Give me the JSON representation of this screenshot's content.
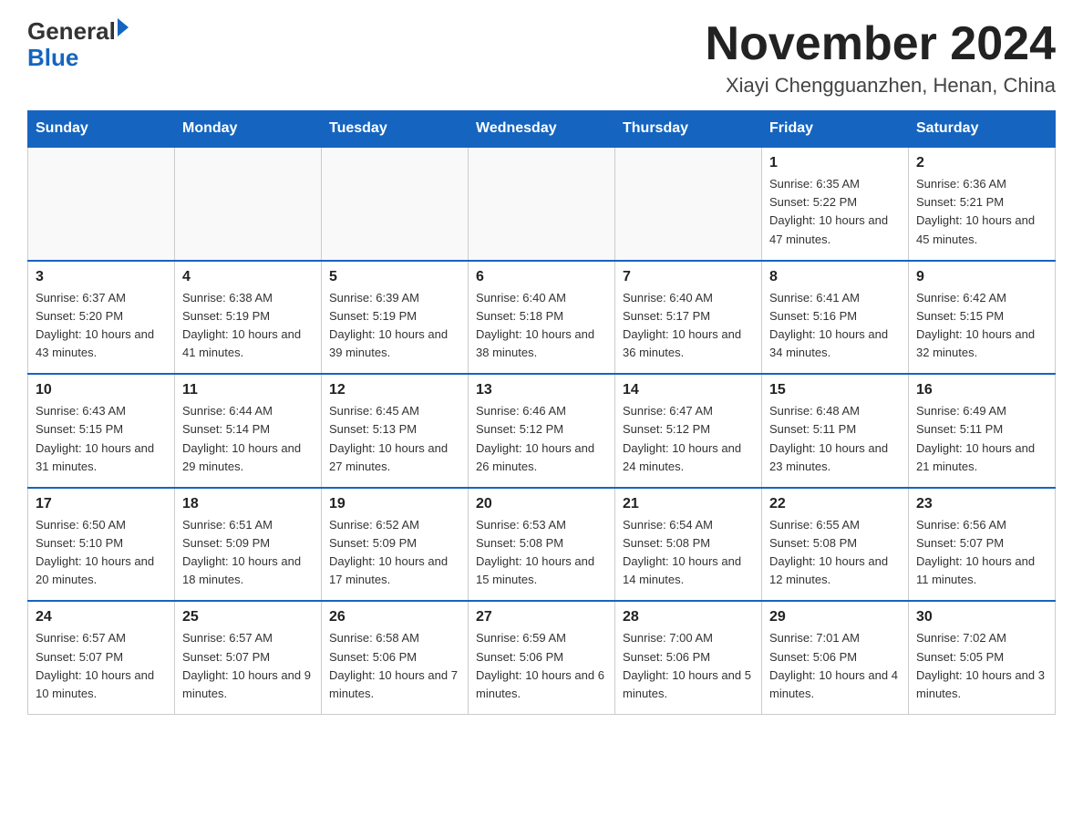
{
  "logo": {
    "general": "General",
    "blue": "Blue"
  },
  "title": "November 2024",
  "subtitle": "Xiayi Chengguanzhen, Henan, China",
  "days_header": [
    "Sunday",
    "Monday",
    "Tuesday",
    "Wednesday",
    "Thursday",
    "Friday",
    "Saturday"
  ],
  "weeks": [
    [
      {
        "day": "",
        "info": ""
      },
      {
        "day": "",
        "info": ""
      },
      {
        "day": "",
        "info": ""
      },
      {
        "day": "",
        "info": ""
      },
      {
        "day": "",
        "info": ""
      },
      {
        "day": "1",
        "info": "Sunrise: 6:35 AM\nSunset: 5:22 PM\nDaylight: 10 hours and 47 minutes."
      },
      {
        "day": "2",
        "info": "Sunrise: 6:36 AM\nSunset: 5:21 PM\nDaylight: 10 hours and 45 minutes."
      }
    ],
    [
      {
        "day": "3",
        "info": "Sunrise: 6:37 AM\nSunset: 5:20 PM\nDaylight: 10 hours and 43 minutes."
      },
      {
        "day": "4",
        "info": "Sunrise: 6:38 AM\nSunset: 5:19 PM\nDaylight: 10 hours and 41 minutes."
      },
      {
        "day": "5",
        "info": "Sunrise: 6:39 AM\nSunset: 5:19 PM\nDaylight: 10 hours and 39 minutes."
      },
      {
        "day": "6",
        "info": "Sunrise: 6:40 AM\nSunset: 5:18 PM\nDaylight: 10 hours and 38 minutes."
      },
      {
        "day": "7",
        "info": "Sunrise: 6:40 AM\nSunset: 5:17 PM\nDaylight: 10 hours and 36 minutes."
      },
      {
        "day": "8",
        "info": "Sunrise: 6:41 AM\nSunset: 5:16 PM\nDaylight: 10 hours and 34 minutes."
      },
      {
        "day": "9",
        "info": "Sunrise: 6:42 AM\nSunset: 5:15 PM\nDaylight: 10 hours and 32 minutes."
      }
    ],
    [
      {
        "day": "10",
        "info": "Sunrise: 6:43 AM\nSunset: 5:15 PM\nDaylight: 10 hours and 31 minutes."
      },
      {
        "day": "11",
        "info": "Sunrise: 6:44 AM\nSunset: 5:14 PM\nDaylight: 10 hours and 29 minutes."
      },
      {
        "day": "12",
        "info": "Sunrise: 6:45 AM\nSunset: 5:13 PM\nDaylight: 10 hours and 27 minutes."
      },
      {
        "day": "13",
        "info": "Sunrise: 6:46 AM\nSunset: 5:12 PM\nDaylight: 10 hours and 26 minutes."
      },
      {
        "day": "14",
        "info": "Sunrise: 6:47 AM\nSunset: 5:12 PM\nDaylight: 10 hours and 24 minutes."
      },
      {
        "day": "15",
        "info": "Sunrise: 6:48 AM\nSunset: 5:11 PM\nDaylight: 10 hours and 23 minutes."
      },
      {
        "day": "16",
        "info": "Sunrise: 6:49 AM\nSunset: 5:11 PM\nDaylight: 10 hours and 21 minutes."
      }
    ],
    [
      {
        "day": "17",
        "info": "Sunrise: 6:50 AM\nSunset: 5:10 PM\nDaylight: 10 hours and 20 minutes."
      },
      {
        "day": "18",
        "info": "Sunrise: 6:51 AM\nSunset: 5:09 PM\nDaylight: 10 hours and 18 minutes."
      },
      {
        "day": "19",
        "info": "Sunrise: 6:52 AM\nSunset: 5:09 PM\nDaylight: 10 hours and 17 minutes."
      },
      {
        "day": "20",
        "info": "Sunrise: 6:53 AM\nSunset: 5:08 PM\nDaylight: 10 hours and 15 minutes."
      },
      {
        "day": "21",
        "info": "Sunrise: 6:54 AM\nSunset: 5:08 PM\nDaylight: 10 hours and 14 minutes."
      },
      {
        "day": "22",
        "info": "Sunrise: 6:55 AM\nSunset: 5:08 PM\nDaylight: 10 hours and 12 minutes."
      },
      {
        "day": "23",
        "info": "Sunrise: 6:56 AM\nSunset: 5:07 PM\nDaylight: 10 hours and 11 minutes."
      }
    ],
    [
      {
        "day": "24",
        "info": "Sunrise: 6:57 AM\nSunset: 5:07 PM\nDaylight: 10 hours and 10 minutes."
      },
      {
        "day": "25",
        "info": "Sunrise: 6:57 AM\nSunset: 5:07 PM\nDaylight: 10 hours and 9 minutes."
      },
      {
        "day": "26",
        "info": "Sunrise: 6:58 AM\nSunset: 5:06 PM\nDaylight: 10 hours and 7 minutes."
      },
      {
        "day": "27",
        "info": "Sunrise: 6:59 AM\nSunset: 5:06 PM\nDaylight: 10 hours and 6 minutes."
      },
      {
        "day": "28",
        "info": "Sunrise: 7:00 AM\nSunset: 5:06 PM\nDaylight: 10 hours and 5 minutes."
      },
      {
        "day": "29",
        "info": "Sunrise: 7:01 AM\nSunset: 5:06 PM\nDaylight: 10 hours and 4 minutes."
      },
      {
        "day": "30",
        "info": "Sunrise: 7:02 AM\nSunset: 5:05 PM\nDaylight: 10 hours and 3 minutes."
      }
    ]
  ]
}
